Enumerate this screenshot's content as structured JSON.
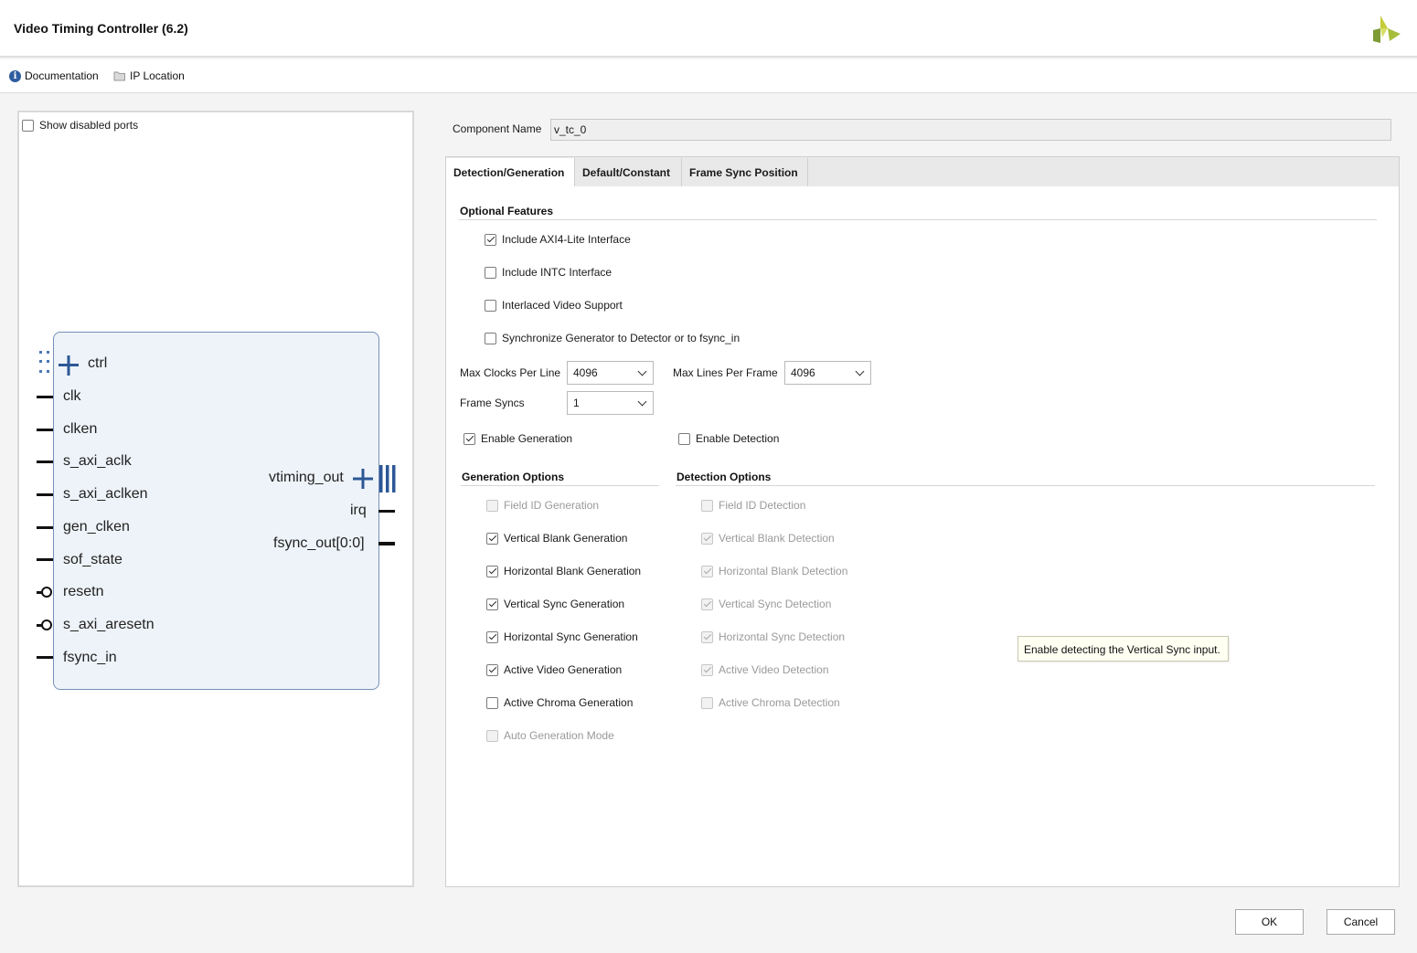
{
  "window": {
    "title": "Video Timing Controller (6.2)"
  },
  "links": {
    "documentation": "Documentation",
    "ip_location": "IP Location"
  },
  "left": {
    "show_disabled_ports": {
      "label": "Show disabled ports",
      "checked": false
    },
    "block": {
      "left_ports": [
        "ctrl",
        "clk",
        "clken",
        "s_axi_aclk",
        "s_axi_aclken",
        "gen_clken",
        "sof_state",
        "resetn",
        "s_axi_aresetn",
        "fsync_in"
      ],
      "right_ports": [
        "vtiming_out",
        "irq",
        "fsync_out[0:0]"
      ]
    }
  },
  "component": {
    "label": "Component Name",
    "value": "v_tc_0"
  },
  "tabs": [
    "Detection/Generation",
    "Default/Constant",
    "Frame Sync Position"
  ],
  "optional_features": {
    "title": "Optional Features",
    "items": [
      {
        "label": "Include AXI4-Lite Interface",
        "checked": true
      },
      {
        "label": "Include INTC Interface",
        "checked": false
      },
      {
        "label": "Interlaced Video Support",
        "checked": false
      },
      {
        "label": "Synchronize Generator to Detector or to fsync_in",
        "checked": false
      }
    ]
  },
  "params": {
    "max_clocks": {
      "label": "Max Clocks Per Line",
      "value": "4096"
    },
    "max_lines": {
      "label": "Max Lines Per Frame",
      "value": "4096"
    },
    "frame_syncs": {
      "label": "Frame Syncs",
      "value": "1"
    }
  },
  "enable": {
    "generation": {
      "label": "Enable Generation",
      "checked": true
    },
    "detection": {
      "label": "Enable Detection",
      "checked": false
    }
  },
  "generation_options": {
    "title": "Generation Options",
    "items": [
      {
        "label": "Field ID Generation",
        "checked": false,
        "disabled": true
      },
      {
        "label": "Vertical Blank Generation",
        "checked": true,
        "disabled": false
      },
      {
        "label": "Horizontal Blank Generation",
        "checked": true,
        "disabled": false
      },
      {
        "label": "Vertical Sync Generation",
        "checked": true,
        "disabled": false
      },
      {
        "label": "Horizontal Sync Generation",
        "checked": true,
        "disabled": false
      },
      {
        "label": "Active Video Generation",
        "checked": true,
        "disabled": false
      },
      {
        "label": "Active Chroma Generation",
        "checked": false,
        "disabled": false
      },
      {
        "label": "Auto Generation Mode",
        "checked": false,
        "disabled": true
      }
    ]
  },
  "detection_options": {
    "title": "Detection Options",
    "items": [
      {
        "label": "Field ID Detection",
        "checked": false,
        "disabled": true
      },
      {
        "label": "Vertical Blank Detection",
        "checked": true,
        "disabled": true
      },
      {
        "label": "Horizontal Blank Detection",
        "checked": true,
        "disabled": true
      },
      {
        "label": "Vertical Sync Detection",
        "checked": true,
        "disabled": true
      },
      {
        "label": "Horizontal Sync Detection",
        "checked": true,
        "disabled": true
      },
      {
        "label": "Active Video Detection",
        "checked": true,
        "disabled": true
      },
      {
        "label": "Active Chroma Detection",
        "checked": false,
        "disabled": true
      }
    ]
  },
  "tooltip": "Enable detecting the Vertical Sync input.",
  "buttons": {
    "ok": "OK",
    "cancel": "Cancel"
  },
  "colors": {
    "accent_blue": "#2e5d9e",
    "block_fill": "#eef3f9",
    "logo_green": "#8aa536"
  }
}
